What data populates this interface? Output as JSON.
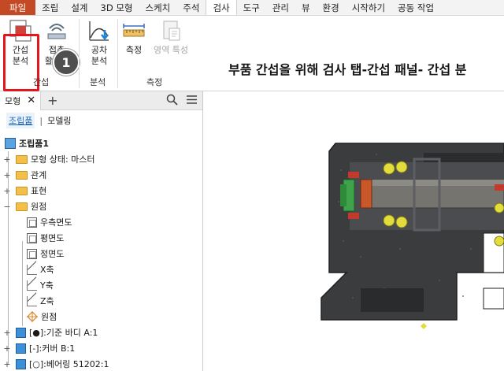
{
  "menu_tabs": [
    {
      "label": "파일"
    },
    {
      "label": "조립"
    },
    {
      "label": "설계"
    },
    {
      "label": "3D 모형"
    },
    {
      "label": "스케치"
    },
    {
      "label": "주석"
    },
    {
      "label": "검사"
    },
    {
      "label": "도구"
    },
    {
      "label": "관리"
    },
    {
      "label": "뷰"
    },
    {
      "label": "환경"
    },
    {
      "label": "시작하기"
    },
    {
      "label": "공동 작업"
    }
  ],
  "active_tab": "검사",
  "ribbon": {
    "interference_analysis": {
      "line1": "간섭",
      "line2": "분석"
    },
    "contact_activation": {
      "line1": "접촉",
      "line2": "활성화"
    },
    "tolerance_analysis": {
      "line1": "공차",
      "line2": "분석"
    },
    "measure": {
      "label": "측정"
    },
    "region_properties": {
      "label": "영역 특성"
    },
    "panels": {
      "interference": "간섭",
      "analysis": "분석",
      "measure": "측정"
    },
    "badge_number": "1"
  },
  "instruction": "부품 간섭을 위해 검사 탭-간섭 패널- 간섭 분",
  "browser": {
    "tab_label": "모형",
    "modes": {
      "assembly": "조립품",
      "modeling": "모델링"
    },
    "tree": [
      {
        "label": "조립품1"
      },
      {
        "label": "모형 상태: 마스터"
      },
      {
        "label": "관계"
      },
      {
        "label": "표현"
      },
      {
        "label": "원점"
      },
      {
        "label": "우측면도"
      },
      {
        "label": "평면도"
      },
      {
        "label": "정면도"
      },
      {
        "label": "X축"
      },
      {
        "label": "Y축"
      },
      {
        "label": "Z축"
      },
      {
        "label": "원점"
      },
      {
        "label": "[●]:기준 바디 A:1"
      },
      {
        "label": "[-]:커버 B:1"
      },
      {
        "label": "[○]:베어링 51202:1"
      }
    ]
  },
  "colors": {
    "file_tab": "#c34a25",
    "highlight": "#e3161e",
    "mode_link": "#1a64b8",
    "part_body": "#3a3c3e",
    "bearing": "#e2dc3c"
  }
}
